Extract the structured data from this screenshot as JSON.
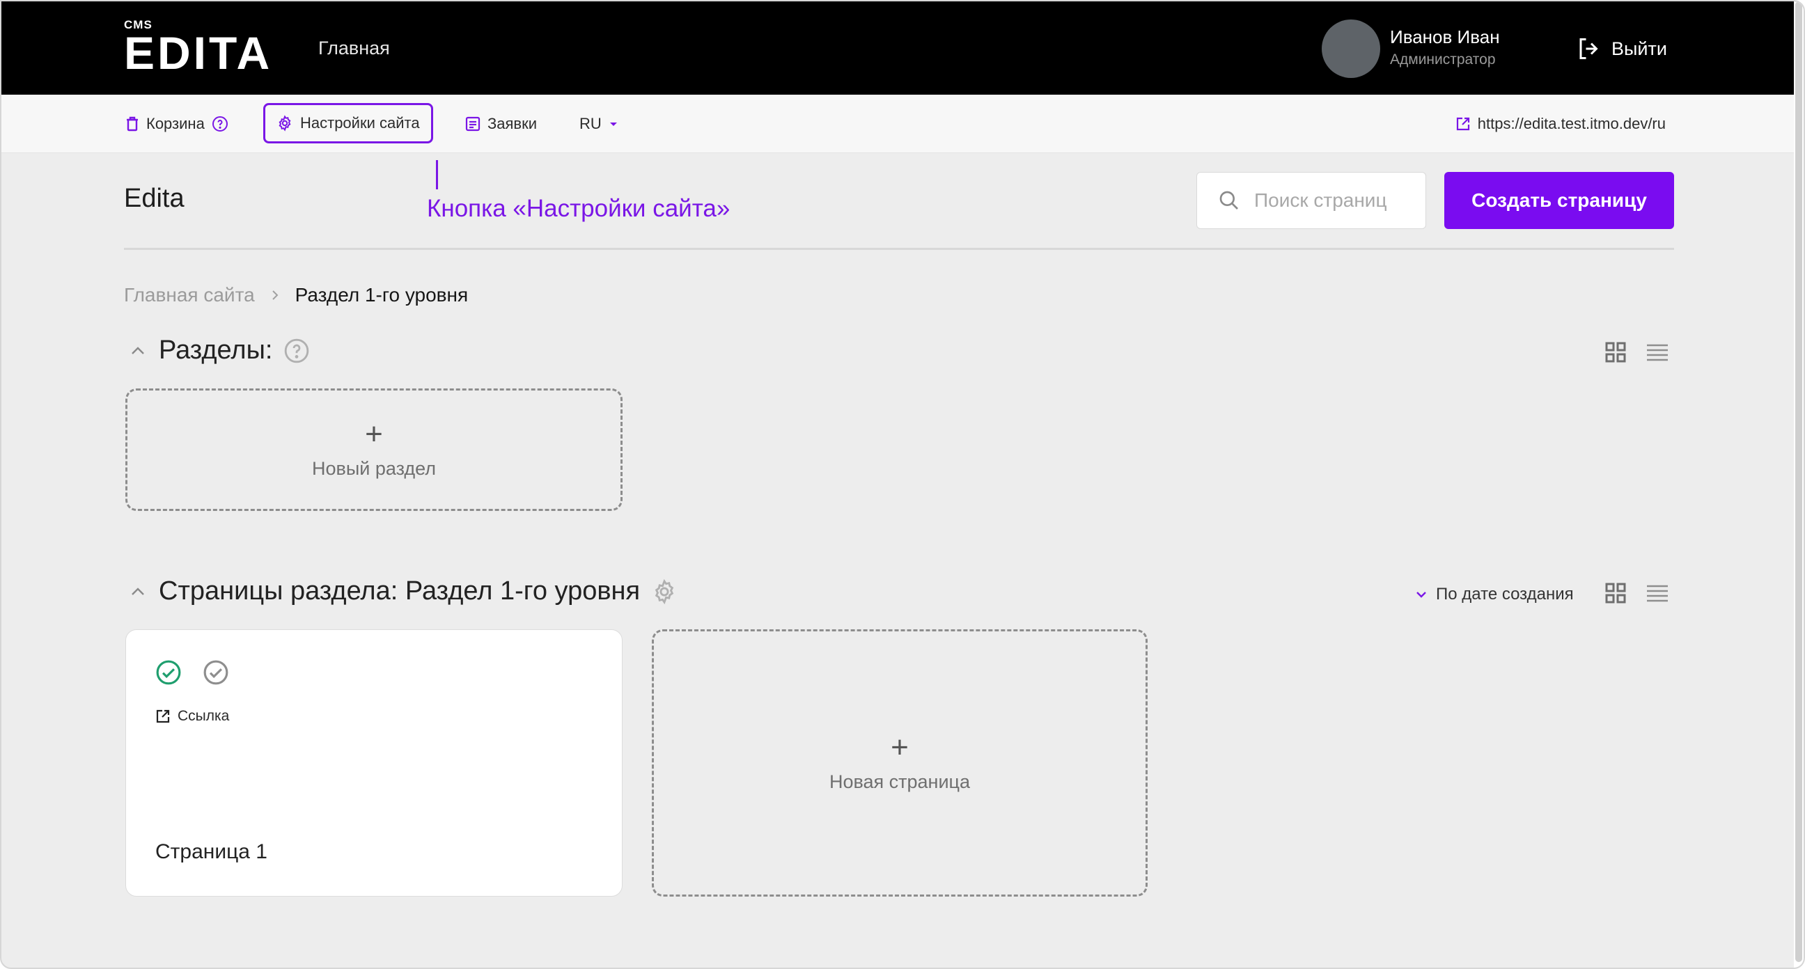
{
  "header": {
    "logo_small": "CMS",
    "logo_main": "EDITA",
    "nav_home": "Главная",
    "user_name": "Иванов Иван",
    "user_role": "Администратор",
    "logout_label": "Выйти"
  },
  "toolbar": {
    "trash_label": "Корзина",
    "settings_label": "Настройки сайта",
    "requests_label": "Заявки",
    "lang_label": "RU",
    "site_url": "https://edita.test.itmo.dev/ru"
  },
  "annotation": {
    "callout_text": "Кнопка «Настройки сайта»"
  },
  "main": {
    "site_title": "Edita",
    "search_placeholder": "Поиск страниц",
    "create_button": "Создать страницу",
    "breadcrumb": {
      "root": "Главная сайта",
      "current": "Раздел 1-го уровня"
    },
    "sections": {
      "title": "Разделы:",
      "new_label": "Новый раздел"
    },
    "pages": {
      "title": "Страницы раздела: Раздел 1-го уровня",
      "sort_label": "По дате создания",
      "new_label": "Новая страница",
      "items": [
        {
          "link_label": "Ссылка",
          "title": "Страница 1"
        }
      ]
    }
  },
  "colors": {
    "accent": "#7a0cf0",
    "header_bg": "#000000",
    "success": "#1f9e6e"
  }
}
